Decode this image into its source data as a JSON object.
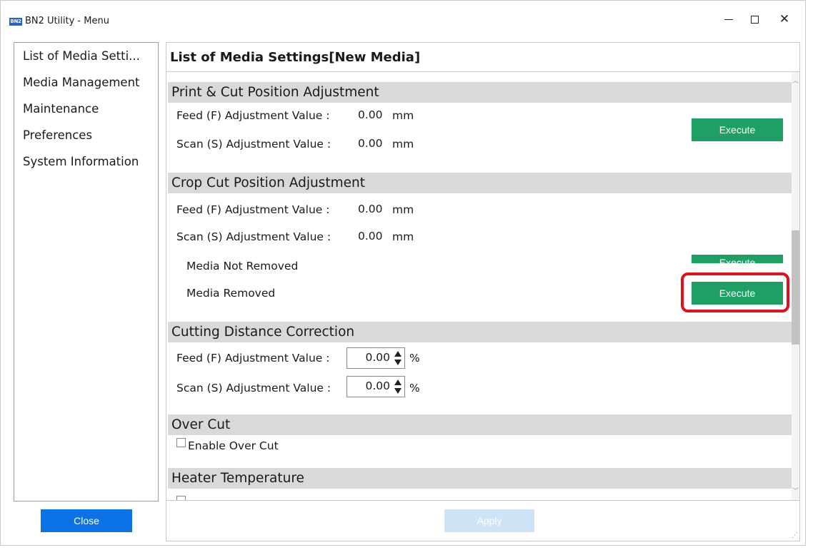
{
  "window": {
    "icon_text": "BN2",
    "title": "BN2 Utility - Menu",
    "minimize_label": "",
    "maximize_label": "",
    "close_label": "✕"
  },
  "sidebar": {
    "items": [
      {
        "label": "List of Media Setti..."
      },
      {
        "label": "Media Management"
      },
      {
        "label": "Maintenance"
      },
      {
        "label": "Preferences"
      },
      {
        "label": "System Information"
      }
    ],
    "close_button": "Close"
  },
  "main": {
    "title": "List of Media Settings[New Media]",
    "apply_button": "Apply",
    "sections": {
      "print_cut": {
        "title": "Print & Cut Position Adjustment",
        "feed_label": "Feed (F) Adjustment Value :",
        "feed_value": "0.00",
        "feed_unit": "mm",
        "scan_label": "Scan (S) Adjustment Value :",
        "scan_value": "0.00",
        "scan_unit": "mm",
        "execute_button": "Execute"
      },
      "crop_cut": {
        "title": "Crop Cut Position Adjustment",
        "feed_label": "Feed (F) Adjustment Value :",
        "feed_value": "0.00",
        "feed_unit": "mm",
        "scan_label": "Scan (S) Adjustment Value :",
        "scan_value": "0.00",
        "scan_unit": "mm",
        "media_not_removed_label": "Media Not Removed",
        "media_not_removed_button": "Execute",
        "media_removed_label": "Media Removed",
        "media_removed_button": "Execute"
      },
      "cutting_distance": {
        "title": "Cutting Distance Correction",
        "feed_label": "Feed (F) Adjustment Value :",
        "feed_value": "0.00",
        "feed_unit": "%",
        "scan_label": "Scan (S) Adjustment Value :",
        "scan_value": "0.00",
        "scan_unit": "%"
      },
      "over_cut": {
        "title": "Over Cut",
        "enable_label": "Enable Over Cut",
        "enabled": false
      },
      "heater": {
        "title": "Heater Temperature"
      }
    }
  },
  "colors": {
    "accent_blue": "#0a74e6",
    "execute_green": "#1e9f63",
    "highlight_red": "#e0101c",
    "section_gray": "#d9d9d9",
    "apply_disabled": "#cfe3f7"
  }
}
